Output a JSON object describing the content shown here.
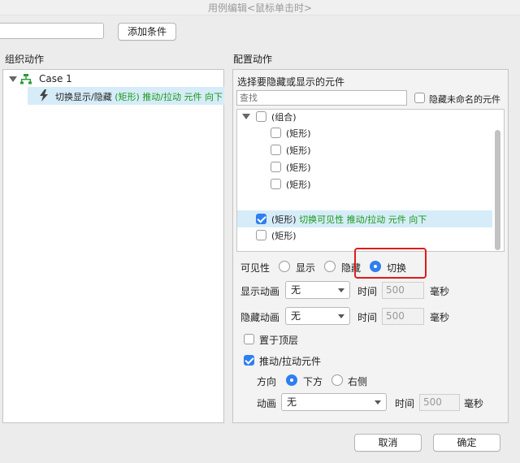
{
  "window": {
    "title": "用例编辑<鼠标单击时>"
  },
  "top": {
    "add_condition": "添加条件"
  },
  "left": {
    "header": "组织动作",
    "case_label": "Case 1",
    "action_prefix": "切换显示/隐藏",
    "action_detail": "(矩形) 推动/拉动 元件 向下"
  },
  "right": {
    "header": "配置动作",
    "select_label": "选择要隐藏或显示的元件",
    "search_placeholder": "查找",
    "hide_unnamed": "隐藏未命名的元件",
    "tree": {
      "group": "(组合)",
      "rect1": "(矩形)",
      "rect2": "(矩形)",
      "rect3": "(矩形)",
      "rect4": "(矩形)",
      "selected_name": "(矩形)",
      "selected_detail": "切换可见性 推动/拉动 元件 向下",
      "rect6": "(矩形)"
    },
    "visibility": {
      "label": "可见性",
      "show": "显示",
      "hide": "隐藏",
      "toggle": "切换",
      "selected": "切换"
    },
    "show_anim": {
      "label": "显示动画",
      "value": "无",
      "time_label": "时间",
      "time": "500",
      "unit": "毫秒"
    },
    "hide_anim": {
      "label": "隐藏动画",
      "value": "无",
      "time_label": "时间",
      "time": "500",
      "unit": "毫秒"
    },
    "bring_top": "置于顶层",
    "push_pull": "推动/拉动元件",
    "direction": {
      "label": "方向",
      "down": "下方",
      "right": "右侧",
      "selected": "下方"
    },
    "anim": {
      "label": "动画",
      "value": "无",
      "time_label": "时间",
      "time": "500",
      "unit": "毫秒"
    }
  },
  "footer": {
    "cancel": "取消",
    "ok": "确定"
  },
  "colors": {
    "accent": "#2e7ff0",
    "highlight_box": "#e01b1b",
    "green_text": "#1a9a1a",
    "selection_row": "#d6ecf8"
  }
}
